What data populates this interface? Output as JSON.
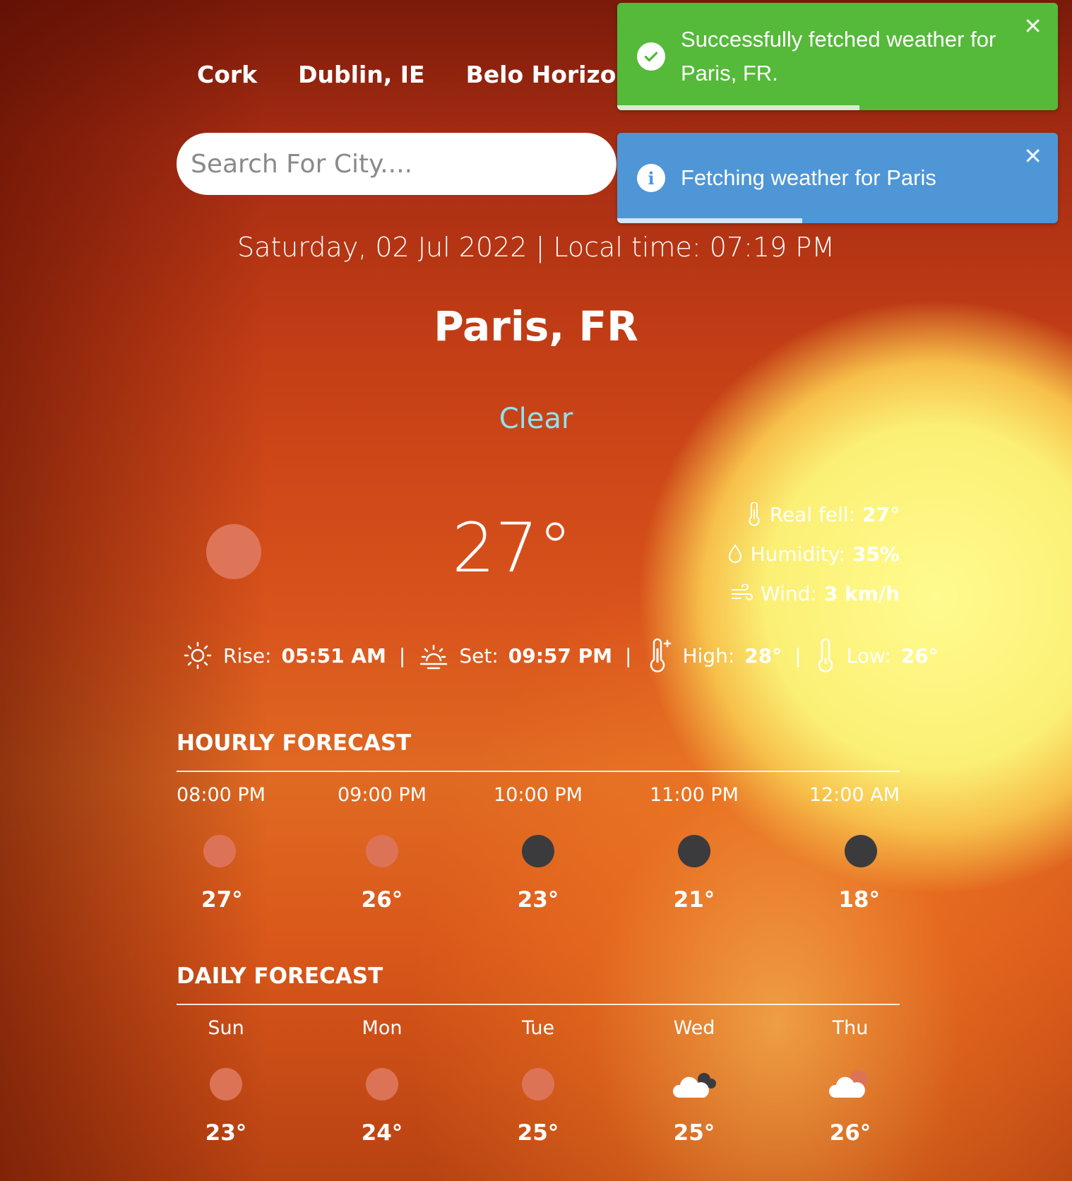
{
  "nav": {
    "cities": [
      "Cork",
      "Dublin, IE",
      "Belo Horizont"
    ]
  },
  "search": {
    "placeholder": "Search For City...."
  },
  "toasts": {
    "success": {
      "message": "Successfully fetched weather for Paris, FR.",
      "progress": 0.55
    },
    "info": {
      "message": "Fetching weather for Paris",
      "progress": 0.42
    }
  },
  "header": {
    "datetime": "Saturday, 02 Jul 2022 | Local time: 07:19 PM",
    "city": "Paris, FR",
    "condition": "Clear"
  },
  "current": {
    "temp": "27°",
    "real_feel_label": "Real fell:",
    "real_feel": "27°",
    "humidity_label": "Humidity:",
    "humidity": "35%",
    "wind_label": "Wind:",
    "wind": "3 km/h"
  },
  "sun": {
    "rise_label": "Rise:",
    "rise": "05:51 AM",
    "set_label": "Set:",
    "set": "09:57 PM",
    "high_label": "High:",
    "high": "28°",
    "low_label": "Low:",
    "low": "26°",
    "sep": "|"
  },
  "hourly": {
    "title": "HOURLY FORECAST",
    "items": [
      {
        "time": "08:00 PM",
        "icon": "sun-icon",
        "temp": "27°"
      },
      {
        "time": "09:00 PM",
        "icon": "sun-icon",
        "temp": "26°"
      },
      {
        "time": "10:00 PM",
        "icon": "moon-icon",
        "temp": "23°"
      },
      {
        "time": "11:00 PM",
        "icon": "moon-icon",
        "temp": "21°"
      },
      {
        "time": "12:00 AM",
        "icon": "moon-icon",
        "temp": "18°"
      }
    ]
  },
  "daily": {
    "title": "DAILY FORECAST",
    "items": [
      {
        "day": "Sun",
        "icon": "sun-icon",
        "temp": "23°"
      },
      {
        "day": "Mon",
        "icon": "sun-icon",
        "temp": "24°"
      },
      {
        "day": "Tue",
        "icon": "sun-icon",
        "temp": "25°"
      },
      {
        "day": "Wed",
        "icon": "cloud-night-icon",
        "temp": "25°"
      },
      {
        "day": "Thu",
        "icon": "cloud-sun-icon",
        "temp": "26°"
      }
    ]
  },
  "colors": {
    "success": "#55b93a",
    "info": "#4f96d6",
    "condition": "#8fe3ee"
  }
}
